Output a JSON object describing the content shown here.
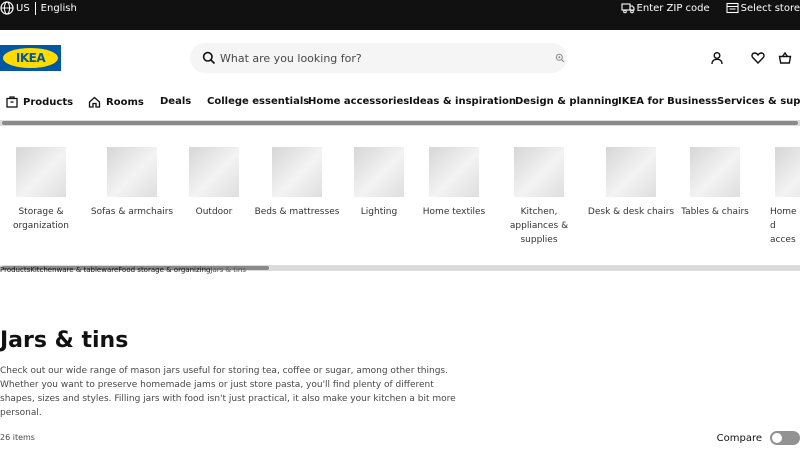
{
  "topbar": {
    "country": "US",
    "language": "English",
    "zip_label": "Enter ZIP code",
    "store_label": "Select store"
  },
  "logo": {
    "text": "IKEA",
    "brand_blue": "#0058a3",
    "brand_yellow": "#ffdb00"
  },
  "search": {
    "placeholder": "What are you looking for?"
  },
  "header_icons": [
    "user-icon",
    "heart-icon",
    "basket-icon"
  ],
  "nav": {
    "items": [
      {
        "label": "Products"
      },
      {
        "label": "Rooms"
      },
      {
        "label": "Deals"
      },
      {
        "label": "College essentials"
      },
      {
        "label": "Home accessories"
      },
      {
        "label": "Ideas & inspiration"
      },
      {
        "label": "Design & planning"
      },
      {
        "label": "IKEA for Business"
      },
      {
        "label": "Services & support"
      }
    ]
  },
  "categories": {
    "items": [
      {
        "label": "Storage & organization"
      },
      {
        "label": "Sofas & armchairs"
      },
      {
        "label": "Outdoor"
      },
      {
        "label": "Beds & mattresses"
      },
      {
        "label": "Lighting"
      },
      {
        "label": "Home textiles"
      },
      {
        "label": "Kitchen, appliances & supplies"
      },
      {
        "label": "Desk & desk chairs"
      },
      {
        "label": "Tables & chairs"
      },
      {
        "label": "Home d acces"
      }
    ]
  },
  "breadcrumb": {
    "items": [
      "Products",
      "Kitchenware & tableware",
      "Food storage & organizing",
      "Jars & tins"
    ]
  },
  "page": {
    "title": "Jars & tins",
    "description": "Check out our wide range of mason jars useful for storing tea, coffee or sugar, among other things. Whether you want to preserve homemade jams or just store pasta, you'll find plenty of different shapes, sizes and styles. Filling jars with food isn't just practical, it also make your kitchen a bit more personal.",
    "count": "26 items",
    "compare_label": "Compare"
  }
}
